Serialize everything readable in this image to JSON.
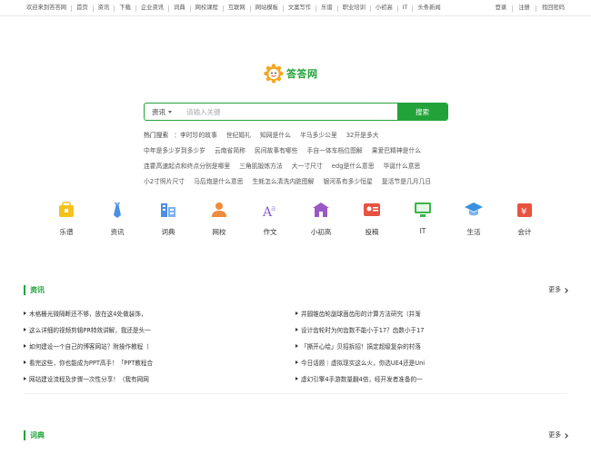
{
  "top_nav": {
    "items": [
      "欢迎来到答答网",
      "首页",
      "资讯",
      "下载",
      "企业资讯",
      "词典",
      "网校课程",
      "互联网",
      "网站模板",
      "文案写作",
      "乐谱",
      "职业培训",
      "小初高",
      "IT",
      "头条新闻"
    ],
    "right": [
      "登录",
      "注册",
      "找回密码"
    ]
  },
  "logo": {
    "text": "答答网"
  },
  "search": {
    "category": "资讯",
    "placeholder": "请输入关键",
    "button": "搜索"
  },
  "hot": {
    "label": "热门搜索",
    "rows": [
      [
        "：李时珍的故事",
        "世纪婚礼",
        "知网是什么",
        "半马多少公里",
        "32开是多大"
      ],
      [
        "中年是多少岁到多少岁",
        "云南省简称",
        "民间故事有哪些",
        "手自一体车档位图解",
        "果爱巴精神是什么"
      ],
      [
        "连霍高速起点和终点分别是哪里",
        "三角肌锻炼方法",
        "大一寸尺寸",
        "edg是什么意思",
        "华诞什么意思"
      ],
      [
        "小2寸照片尺寸",
        "马后炮是什么意思",
        "生蚝怎么清洗内脏图解",
        "银河系有多少恒星",
        "复活节是几月几日"
      ]
    ]
  },
  "categories": [
    {
      "label": "乐谱",
      "icon": "music-bag-icon",
      "color": "#f5c21c"
    },
    {
      "label": "资讯",
      "icon": "tie-icon",
      "color": "#4a8fe6"
    },
    {
      "label": "词典",
      "icon": "building-icon",
      "color": "#4a8fe6"
    },
    {
      "label": "网校",
      "icon": "person-icon",
      "color": "#f08a3c"
    },
    {
      "label": "作文",
      "icon": "font-icon",
      "color": "#8a5cd6"
    },
    {
      "label": "小初高",
      "icon": "school-icon",
      "color": "#9b59c6"
    },
    {
      "label": "投稿",
      "icon": "id-card-icon",
      "color": "#e8523f"
    },
    {
      "label": "IT",
      "icon": "monitor-icon",
      "color": "#3bb54a"
    },
    {
      "label": "生活",
      "icon": "graduation-cap-icon",
      "color": "#3a8fe0"
    },
    {
      "label": "会计",
      "icon": "yen-box-icon",
      "color": "#e8523f"
    }
  ],
  "section_news": {
    "title": "资讯",
    "more": "更多",
    "left": [
      "木格栅光微隔断还不够，放在这4处做装饰，",
      "这么详细的视频剪辑PR特效讲解，我还是头一",
      "如何建设一个自己的博客网站？附操作教程（",
      "看完这些，你也能成为PPT高手！「PPT教程合",
      "网站建设流程及步骤一次性分享！（我有网网"
    ],
    "right": [
      "井圆锥齿轮副球面齿形的计算方法研究（井渐",
      "设计齿轮时为何齿数不能小于17？齿数小于17",
      "「撕开心绘」贝招拆招！搞定超级复杂的村落",
      "今日话题｜虚拟现实这么火，你选UE4还是Uni",
      "虚幻引擎4手游数量翻4倍，经开发者准备的一"
    ]
  },
  "section_dict": {
    "title": "词典",
    "more": "更多"
  }
}
